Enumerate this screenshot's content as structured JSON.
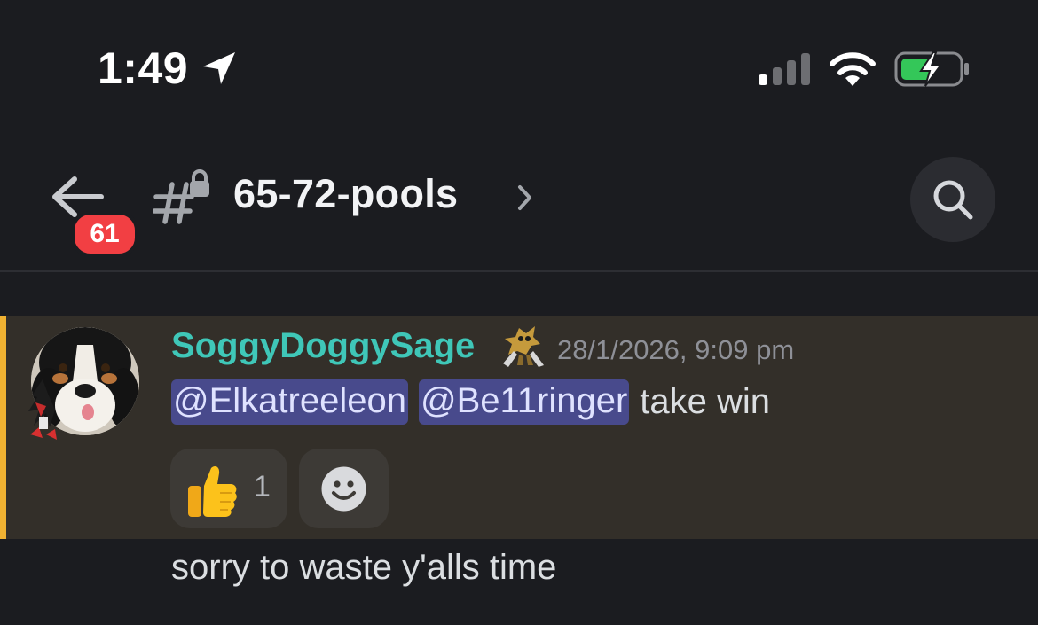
{
  "status_bar": {
    "time": "1:49"
  },
  "header": {
    "unread_count": "61",
    "channel_name": "65-72-pools"
  },
  "message": {
    "author": "SoggyDoggySage",
    "timestamp": "28/1/2026, 9:09 pm",
    "mentions": [
      "@Elkatreeleon",
      "@Be11ringer"
    ],
    "text": "take win",
    "reaction": {
      "emoji": "thumbs-up",
      "count": "1"
    }
  },
  "followup_message": {
    "text": "sorry to waste y'alls time"
  },
  "colors": {
    "background": "#1b1c20",
    "highlight": "#332f29",
    "mention_bar": "#f0b232",
    "author": "#3fc7b8",
    "mention_bg": "#484a8c",
    "badge": "#f23f43"
  }
}
